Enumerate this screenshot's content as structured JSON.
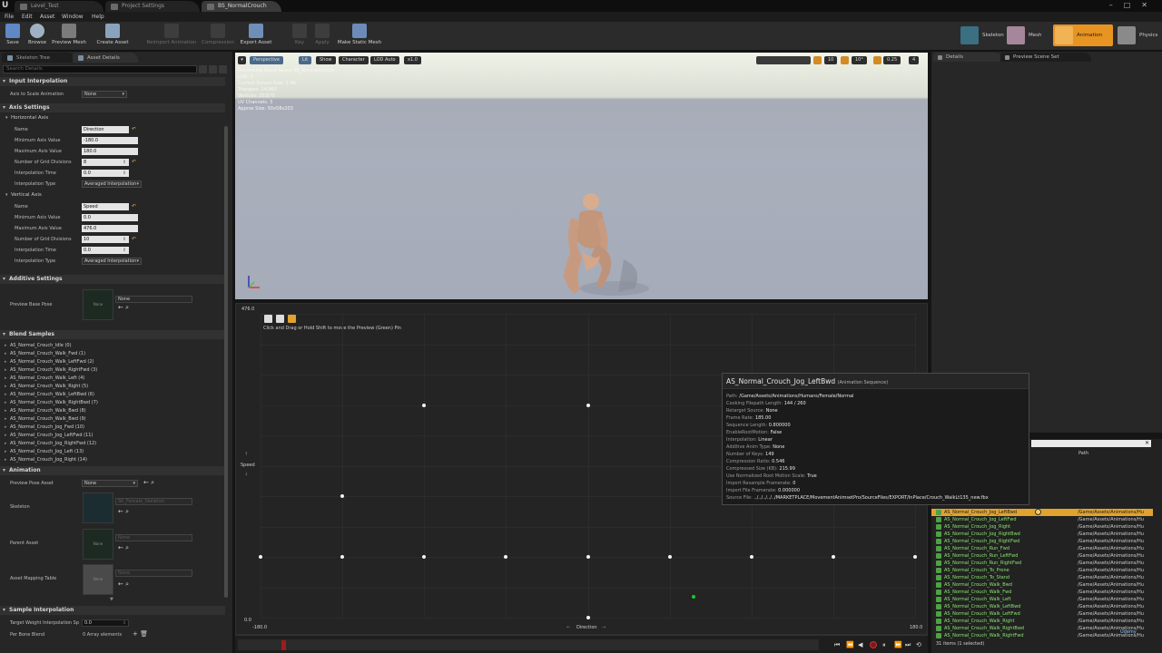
{
  "tabs": [
    "Level_Test",
    "Project Settings",
    "BS_NormalCrouch"
  ],
  "menu": [
    "File",
    "Edit",
    "Asset",
    "Window",
    "Help"
  ],
  "toolbar": {
    "buttons": [
      {
        "label": "Save",
        "icon": "save-icon"
      },
      {
        "label": "Browse",
        "icon": "browse-icon"
      },
      {
        "label": "Preview Mesh",
        "icon": "preview-mesh-icon"
      },
      {
        "label": "Create Asset",
        "icon": "create-asset-icon"
      },
      {
        "label": "Reimport Animation",
        "icon": "reimport-icon"
      },
      {
        "label": "Compression",
        "icon": "compression-icon"
      },
      {
        "label": "Export Asset",
        "icon": "export-asset-icon"
      },
      {
        "label": "Key",
        "icon": "key-icon"
      },
      {
        "label": "Apply",
        "icon": "apply-icon"
      },
      {
        "label": "Make Static Mesh",
        "icon": "make-static-mesh-icon"
      }
    ],
    "modes": [
      "Skeleton",
      "Mesh",
      "Animation",
      "Physics"
    ]
  },
  "left": {
    "tabs": [
      "Skeleton Tree",
      "Asset Details"
    ],
    "search_placeholder": "Search Details",
    "input_interpolation": {
      "title": "Input Interpolation",
      "axis_to_scale_label": "Axis to Scale Animation",
      "axis_to_scale_value": "None"
    },
    "axis_settings": {
      "title": "Axis Settings",
      "horizontal": {
        "title": "Horizontal Axis",
        "name_label": "Name",
        "name_value": "Direction",
        "min_label": "Minimum Axis Value",
        "min_value": "-180.0",
        "max_label": "Maximum Axis Value",
        "max_value": "180.0",
        "grid_label": "Number of Grid Divisions",
        "grid_value": "8",
        "interp_time_label": "Interpolation Time",
        "interp_time_value": "0.0",
        "interp_type_label": "Interpolation Type",
        "interp_type_value": "Averaged Interpolation"
      },
      "vertical": {
        "title": "Vertical Axis",
        "name_label": "Name",
        "name_value": "Speed",
        "min_label": "Minimum Axis Value",
        "min_value": "0.0",
        "max_label": "Maximum Axis Value",
        "max_value": "476.0",
        "grid_label": "Number of Grid Divisions",
        "grid_value": "10",
        "interp_time_label": "Interpolation Time",
        "interp_time_value": "0.0",
        "interp_type_label": "Interpolation Type",
        "interp_type_value": "Averaged Interpolation"
      }
    },
    "additive": {
      "title": "Additive Settings",
      "preview_base_pose_label": "Preview Base Pose",
      "thumb_text": "None",
      "dropdown_value": "None"
    },
    "blend_samples": {
      "title": "Blend Samples",
      "items": [
        "AS_Normal_Crouch_Idle (0)",
        "AS_Normal_Crouch_Walk_Fwd (1)",
        "AS_Normal_Crouch_Walk_LeftFwd (2)",
        "AS_Normal_Crouch_Walk_RightFwd (3)",
        "AS_Normal_Crouch_Walk_Left (4)",
        "AS_Normal_Crouch_Walk_Right (5)",
        "AS_Normal_Crouch_Walk_LeftBwd (6)",
        "AS_Normal_Crouch_Walk_RightBwd (7)",
        "AS_Normal_Crouch_Walk_Bwd (8)",
        "AS_Normal_Crouch_Walk_Bwd (9)",
        "AS_Normal_Crouch_Jog_Fwd (10)",
        "AS_Normal_Crouch_Jog_LeftFwd (11)",
        "AS_Normal_Crouch_Jog_RightFwd (12)",
        "AS_Normal_Crouch_Jog_Left (13)",
        "AS_Normal_Crouch_Jog_Right (14)"
      ]
    },
    "animation": {
      "title": "Animation",
      "preview_pose_label": "Preview Pose Asset",
      "preview_pose_value": "None",
      "skeleton_label": "Skeleton",
      "skeleton_value": "SK_Female_Skeleton",
      "parent_label": "Parent Asset",
      "parent_thumb": "None",
      "parent_value": "None",
      "mapping_label": "Asset Mapping Table",
      "mapping_thumb": "None",
      "mapping_value": "None"
    },
    "sample_interp": {
      "title": "Sample Interpolation",
      "target_label": "Target Weight Interpolation Sp",
      "target_value": "0.0",
      "per_bone_label": "Per Bone Blend",
      "per_bone_value": "0 Array elements"
    }
  },
  "viewport": {
    "buttons": [
      "Perspective",
      "Lit",
      "Show",
      "Character",
      "LOD Auto",
      "x1.0"
    ],
    "right_buttons": [
      "10",
      "10°",
      "0.25",
      "4"
    ],
    "overlay": [
      "Previewing Blend Space BS_NormalCrouch",
      "LOD: 0",
      "Current Screen Size: 1.46",
      "Triangles: 24,962",
      "Vertices: 20,870",
      "UV Channels: 3",
      "Approx Size: 50x58x203"
    ]
  },
  "blendspace": {
    "instruction": "Click and Drag or Hold Shift to move the Preview (Green) Pin",
    "y_max_label": "476.0",
    "y_min_label": "0.0",
    "x_min_label": "-180.0",
    "x_max_label": "180.0",
    "y_axis_name": "Speed",
    "x_axis_name": "Direction",
    "samples": [
      {
        "direction": -90,
        "speed": 333.2
      },
      {
        "direction": 0,
        "speed": 333.2
      },
      {
        "direction": 90,
        "speed": 333.2
      },
      {
        "direction": -135,
        "speed": 190.4
      },
      {
        "direction": -180,
        "speed": 95.2
      },
      {
        "direction": -135,
        "speed": 95.2
      },
      {
        "direction": -90,
        "speed": 95.2
      },
      {
        "direction": -45,
        "speed": 95.2
      },
      {
        "direction": 0,
        "speed": 95.2
      },
      {
        "direction": 45,
        "speed": 95.2
      },
      {
        "direction": 90,
        "speed": 95.2
      },
      {
        "direction": 135,
        "speed": 95.2
      },
      {
        "direction": 180,
        "speed": 95.2
      },
      {
        "direction": 0,
        "speed": 0
      }
    ],
    "preview_pin": {
      "direction": 58,
      "speed": 33
    }
  },
  "tooltip": {
    "title": "AS_Normal_Crouch_Jog_LeftBwd",
    "subtitle": "(Animation Sequence)",
    "rows": [
      {
        "k": "Path:",
        "v": "/Game/Assets/Animations/Humans/Female/Normal"
      },
      {
        "k": "Cooking Filepath Length:",
        "v": "144 / 260"
      },
      {
        "k": "Retarget Source:",
        "v": "None"
      },
      {
        "k": "Frame Rate:",
        "v": "185.00"
      },
      {
        "k": "Sequence Length:",
        "v": "0.800000"
      },
      {
        "k": "EnableRootMotion:",
        "v": "False"
      },
      {
        "k": "Interpolation:",
        "v": "Linear"
      },
      {
        "k": "Additive Anim Type:",
        "v": "None"
      },
      {
        "k": "Number of Keys:",
        "v": "149"
      },
      {
        "k": "Compression Ratio:",
        "v": "0.546"
      },
      {
        "k": "Compressed Size (KB):",
        "v": "215.99"
      },
      {
        "k": "Use Normalized Root Motion Scale:",
        "v": "True"
      },
      {
        "k": "Import Resample Framerate:",
        "v": "0"
      },
      {
        "k": "Import File Framerate:",
        "v": "0.000000"
      },
      {
        "k": "Source File:",
        "v": "../../../../../MARKETPLACE/MovementAnimsetPro/SourceFiles/EXPORT/InPlace/Crouch_WalkLt135_new.fbx"
      }
    ]
  },
  "right": {
    "tabs": [
      "Details",
      "Preview Scene Set"
    ]
  },
  "assets": {
    "path_header": "Path",
    "path_value": "/Game/Assets/Animations/Hu",
    "selected_index": 0,
    "names": [
      "AS_Normal_Crouch_Jog_LeftBwd",
      "AS_Normal_Crouch_Jog_LeftFwd",
      "AS_Normal_Crouch_Jog_Right",
      "AS_Normal_Crouch_Jog_RightBwd",
      "AS_Normal_Crouch_Jog_RightFwd",
      "AS_Normal_Crouch_Run_Fwd",
      "AS_Normal_Crouch_Run_LeftFwd",
      "AS_Normal_Crouch_Run_RightFwd",
      "AS_Normal_Crouch_To_Prone",
      "AS_Normal_Crouch_To_Stand",
      "AS_Normal_Crouch_Walk_Bwd",
      "AS_Normal_Crouch_Walk_Fwd",
      "AS_Normal_Crouch_Walk_Left",
      "AS_Normal_Crouch_Walk_LeftBwd",
      "AS_Normal_Crouch_Walk_LeftFwd",
      "AS_Normal_Crouch_Walk_Right",
      "AS_Normal_Crouch_Walk_RightBwd",
      "AS_Normal_Crouch_Walk_RightFwd"
    ],
    "status": "31 items (1 selected)"
  },
  "colors": {
    "accent": "#e79422",
    "preview_pin": "#1fc62f",
    "asset_green": "#8ae86e"
  }
}
